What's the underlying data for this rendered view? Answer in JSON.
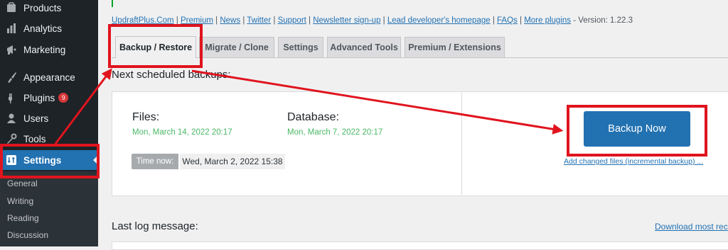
{
  "sidebar": {
    "items": [
      {
        "label": "Products",
        "icon": "products-icon"
      },
      {
        "label": "Analytics",
        "icon": "analytics-icon"
      },
      {
        "label": "Marketing",
        "icon": "marketing-icon"
      },
      {
        "label": "Appearance",
        "icon": "appearance-icon"
      },
      {
        "label": "Plugins",
        "icon": "plugins-icon",
        "badge": "9"
      },
      {
        "label": "Users",
        "icon": "users-icon"
      },
      {
        "label": "Tools",
        "icon": "tools-icon"
      },
      {
        "label": "Settings",
        "icon": "settings-icon"
      }
    ],
    "submenu": [
      "General",
      "Writing",
      "Reading",
      "Discussion"
    ]
  },
  "header": {
    "links": [
      "UpdraftPlus.Com",
      "Premium",
      "News",
      "Twitter",
      "Support",
      "Newsletter sign-up",
      "Lead developer's homepage",
      "FAQs",
      "More plugins"
    ],
    "version_text": "- Version: 1.22.3"
  },
  "tabs": [
    "Backup / Restore",
    "Migrate / Clone",
    "Settings",
    "Advanced Tools",
    "Premium / Extensions"
  ],
  "schedule": {
    "title": "Next scheduled backups:",
    "files_label": "Files:",
    "files_date": "Mon, March 14, 2022 20:17",
    "database_label": "Database:",
    "database_date": "Mon, March 7, 2022 20:17",
    "time_now_label": "Time now:",
    "time_now_value": "Wed, March 2, 2022 15:38"
  },
  "actions": {
    "backup_now": "Backup Now",
    "incremental_link": "Add changed files (incremental backup) ..."
  },
  "log": {
    "title": "Last log message:",
    "download_link": "Download most rec"
  },
  "colors": {
    "sidebar_bg": "#1d2327",
    "accent": "#2271b1",
    "annotation_red": "#e0141e",
    "date_green": "#4ab866",
    "badge_red": "#d63638"
  }
}
